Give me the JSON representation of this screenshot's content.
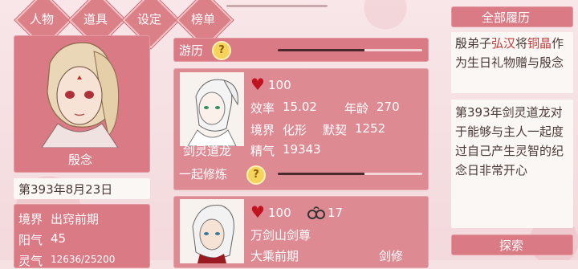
{
  "nav": {
    "tabs": [
      {
        "label": "人物"
      },
      {
        "label": "道具"
      },
      {
        "label": "设定"
      },
      {
        "label": "榜单"
      }
    ]
  },
  "player": {
    "name": "殷念",
    "date": "第393年8月23日",
    "realm_label": "境界",
    "realm": "出窍前期",
    "yangqi_label": "阳气",
    "yangqi": "45",
    "lingqi_label": "灵气",
    "lingqi": "12636/25200"
  },
  "youli": {
    "label": "游历",
    "progress": 0.6
  },
  "companion1": {
    "name": "剑灵道龙",
    "hearts": "100",
    "efficiency_label": "效率",
    "efficiency": "15.02",
    "age_label": "年龄",
    "age": "270",
    "realm_label": "境界",
    "realm": "化形",
    "bond_label": "默契",
    "bond": "1252",
    "essence_label": "精气",
    "essence": "19343",
    "action_label": "一起修炼",
    "action_progress": 0.6
  },
  "companion2": {
    "hearts": "100",
    "cuffs": "17",
    "sect": "万剑山剑尊",
    "realm": "大乘前期",
    "role": "剑修"
  },
  "history": {
    "title": "全部履历",
    "entry1": {
      "p1": "殷弟子",
      "h1": "弘汉",
      "p2": "将",
      "h2": "铜晶",
      "p3": "作为生日礼物赠与殷念"
    },
    "entry2": "第393年剑灵道龙对于能够与主人一起度过自己产生灵智的纪念日非常开心",
    "footer": "探索"
  },
  "colors": {
    "panel": "#d97a84",
    "accent": "#dc8088",
    "highlight": "#c03a3a",
    "heart": "#c1121f"
  }
}
